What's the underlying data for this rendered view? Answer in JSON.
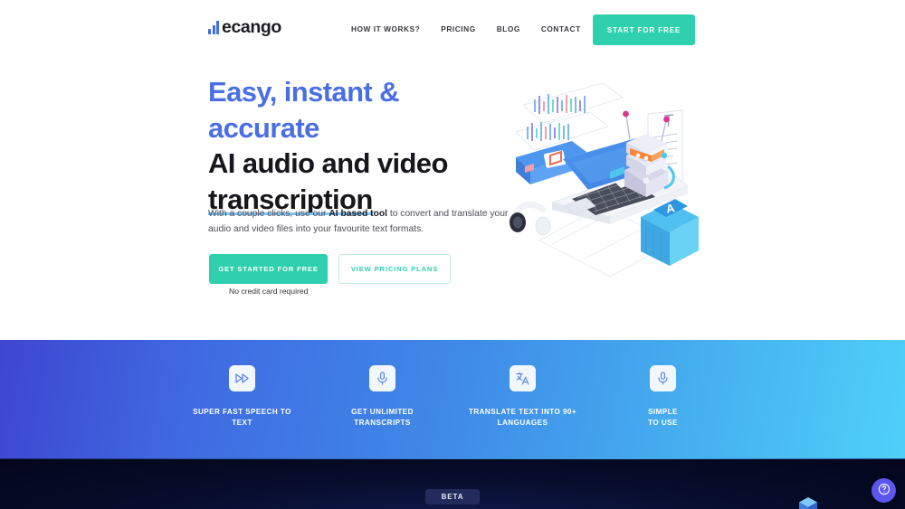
{
  "header": {
    "logo": {
      "text": "ecango",
      "icon": "bar-chart-logo-icon"
    },
    "nav": [
      {
        "label": "HOW IT WORKS?"
      },
      {
        "label": "PRICING"
      },
      {
        "label": "BLOG"
      },
      {
        "label": "CONTACT"
      }
    ],
    "cta": {
      "label": "START FOR FREE",
      "color": "#2ed0ad"
    }
  },
  "hero": {
    "heading_line1": "Easy, instant & accurate",
    "heading_line2": "AI audio and video",
    "heading_line3": "transcription",
    "heading_line1_color": "#4a6fe3",
    "heading_underline_color": "#7fc3f5",
    "subtext_before": "With a couple clicks, use our ",
    "subtext_bold": "AI based tool",
    "subtext_after": " to convert and translate your audio and video files into your favourite text formats.",
    "primary_button": "GET STARTED FOR FREE",
    "secondary_button": "VIEW PRICING PLANS",
    "note": "No credit card required",
    "illustration": "isometric-ai-transcription-illustration"
  },
  "band": {
    "gradient_from": "#3e46d0",
    "gradient_to": "#4fd0f8",
    "features": [
      {
        "icon": "fast-forward-icon",
        "label_line1": "SUPER FAST SPEECH TO",
        "label_line2": "TEXT"
      },
      {
        "icon": "microphone-icon",
        "label_line1": "GET UNLIMITED",
        "label_line2": "TRANSCRIPTS"
      },
      {
        "icon": "translate-icon",
        "label_line1": "TRANSLATE TEXT INTO 90+",
        "label_line2": "LANGUAGES"
      },
      {
        "icon": "microphone-icon",
        "label_line1": "SIMPLE",
        "label_line2": "TO USE"
      }
    ]
  },
  "dark_section": {
    "beta_badge": "BETA",
    "background": "#03061a",
    "help_button": {
      "icon": "question-mark-icon",
      "color": "#5b56ee"
    },
    "cube": "blue-cube-decoration"
  }
}
